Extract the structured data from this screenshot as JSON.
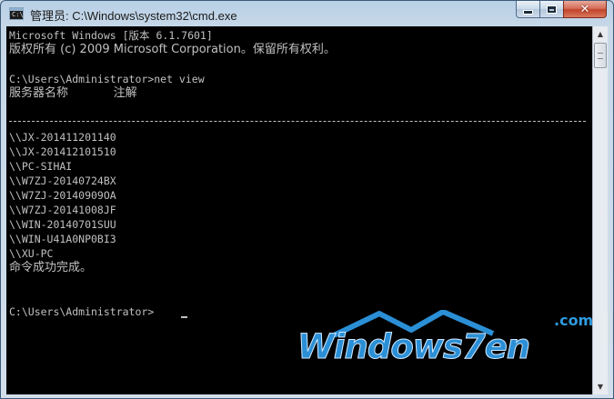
{
  "window": {
    "title": "管理员: C:\\Windows\\system32\\cmd.exe",
    "icon_text": "C:\\",
    "controls": {
      "minimize_icon": "minimize-icon",
      "maximize_icon": "maximize-icon",
      "close_icon": "close-icon",
      "close_glyph": "✕"
    }
  },
  "console": {
    "background": "#000000",
    "text_color": "#c0c0c0",
    "lines": [
      "Microsoft Windows [版本 6.1.7601]",
      "版权所有 (c) 2009 Microsoft Corporation。保留所有权利。",
      "",
      "C:\\Users\\Administrator>net view",
      "服务器名称            注解",
      "",
      "",
      "\\\\JX-201411201140",
      "\\\\JX-201412101510",
      "\\\\PC-SIHAI",
      "\\\\W7ZJ-20140724BX",
      "\\\\W7ZJ-20140909OA",
      "\\\\W7ZJ-20141008JF",
      "\\\\WIN-20140701SUU",
      "\\\\WIN-U41A0NP0BI3",
      "\\\\XU-PC",
      "命令成功完成。",
      "",
      "",
      "C:\\Users\\Administrator>"
    ]
  },
  "watermark": {
    "text": "Windows7en",
    "domain": ".com",
    "color": "#2b8fd6"
  },
  "scrollbar": {
    "up_arrow": "▲",
    "down_arrow": "▼"
  }
}
